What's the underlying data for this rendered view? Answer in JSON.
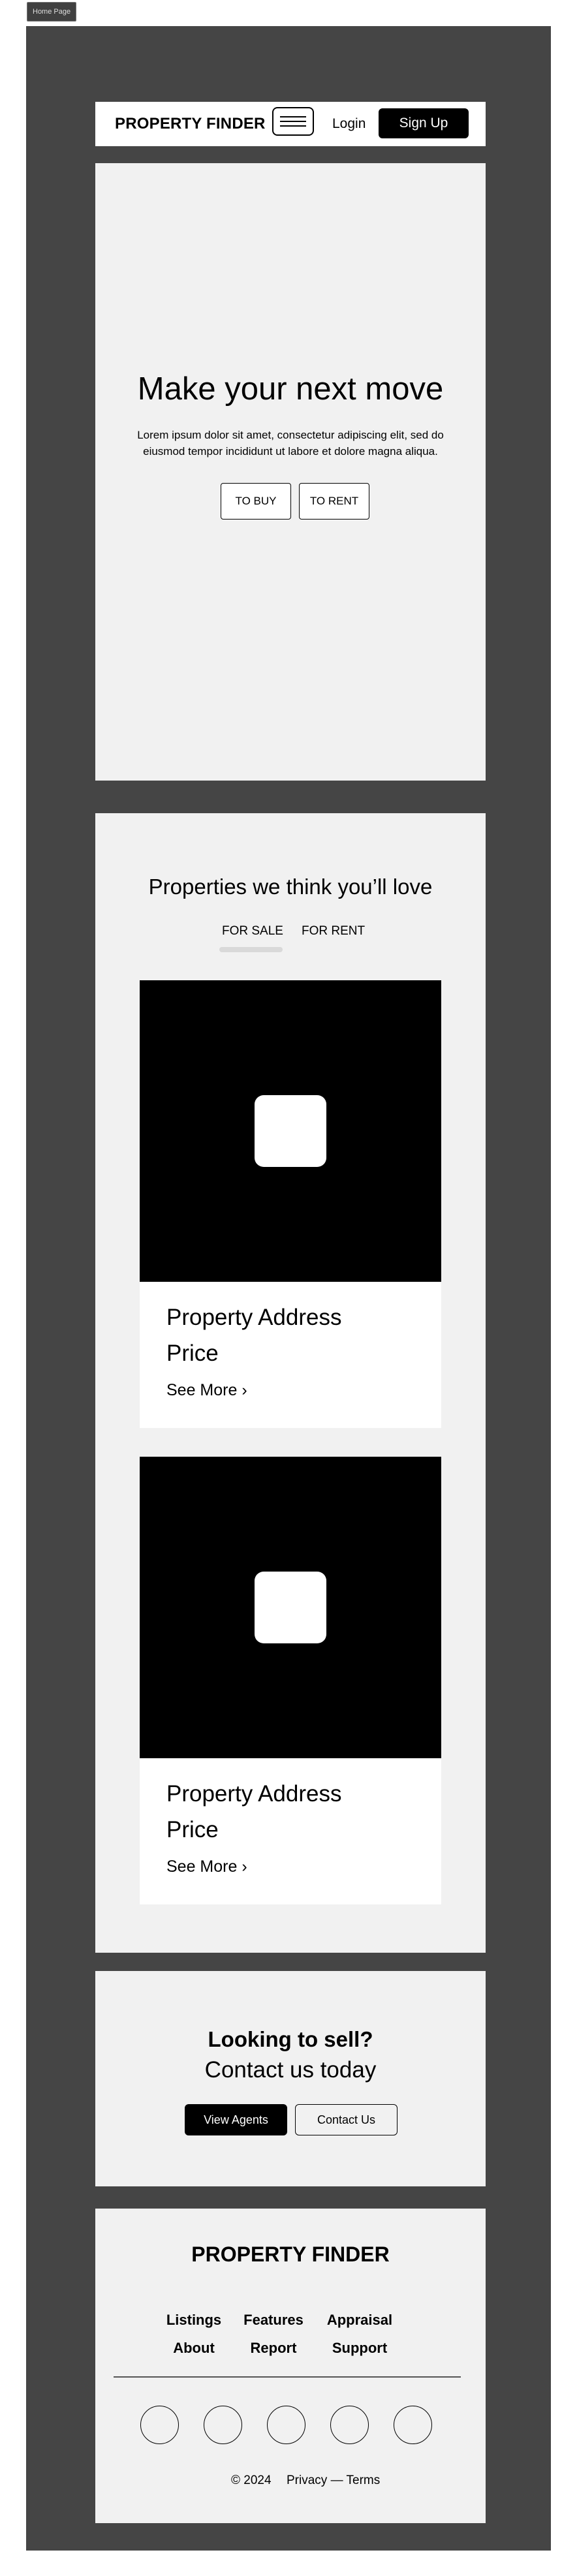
{
  "page_tag": "Home Page",
  "header": {
    "logo": "PROPERTY FINDER",
    "menu_icon": "hamburger-menu-icon",
    "login": "Login",
    "signup": "Sign Up"
  },
  "hero": {
    "title": "Make your next move",
    "text": "Lorem ipsum dolor sit amet, consectetur adipiscing elit, sed do eiusmod tempor incididunt ut labore et dolore magna aliqua.",
    "buttons": [
      "TO BUY",
      "TO RENT"
    ]
  },
  "properties": {
    "title": "Properties we think you’ll love",
    "tabs": [
      "FOR SALE",
      "FOR RENT"
    ],
    "active_tab": "FOR SALE",
    "cards": [
      {
        "address": "Property Address",
        "price": "Price",
        "more": "See More ›",
        "image_icon": "image-placeholder-icon"
      },
      {
        "address": "Property Address",
        "price": "Price",
        "more": "See More ›",
        "image_icon": "image-placeholder-icon"
      }
    ]
  },
  "sell": {
    "title": "Looking to sell?",
    "subtitle": "Contact us today",
    "primary": "View Agents",
    "secondary": "Contact Us"
  },
  "footer": {
    "logo": "PROPERTY FINDER",
    "links_row1": [
      "Listings",
      "Features",
      "Appraisal"
    ],
    "links_row2": [
      "About",
      "Report",
      "Support"
    ],
    "social_icons": [
      "social-icon-1",
      "social-icon-2",
      "social-icon-3",
      "social-icon-4",
      "social-icon-5"
    ],
    "copyright": "© 2024",
    "legal": "Privacy — Terms"
  },
  "colors": {
    "frame_bg": "#454545",
    "section_bg": "#f1f1f1",
    "accent": "#000000"
  }
}
